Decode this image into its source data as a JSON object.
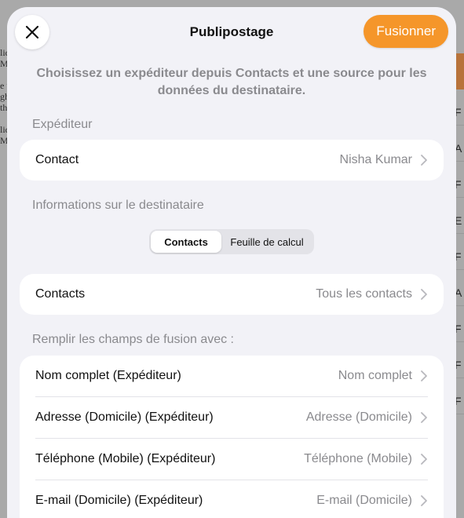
{
  "header": {
    "title": "Publipostage",
    "merge_label": "Fusionner"
  },
  "intro": "Choisissez un expéditeur depuis Contacts et une source pour les données du destinataire.",
  "sender": {
    "section_label": "Expéditeur",
    "row": {
      "label": "Contact",
      "value": "Nisha Kumar"
    }
  },
  "recipient": {
    "section_label": "Informations sur le destinataire",
    "segments": [
      "Contacts",
      "Feuille de calcul"
    ],
    "selected_segment": "Contacts",
    "row": {
      "label": "Contacts",
      "value": "Tous les contacts"
    }
  },
  "merge_fields": {
    "section_label": "Remplir les champs de fusion avec :",
    "rows": [
      {
        "label": "Nom complet (Expéditeur)",
        "value": "Nom complet"
      },
      {
        "label": "Adresse (Domicile) (Expéditeur)",
        "value": "Adresse (Domicile)"
      },
      {
        "label": "Téléphone (Mobile) (Expéditeur)",
        "value": "Téléphone (Mobile)"
      },
      {
        "label": "E-mail (Domicile) (Expéditeur)",
        "value": "E-mail (Domicile)"
      }
    ]
  },
  "background": {
    "left_fragments": [
      "lic",
      "M",
      "",
      "e t",
      "gh",
      "th",
      "",
      "lic",
      "M"
    ],
    "right_fragments": [
      "F",
      "A",
      "F",
      "E",
      "F",
      "A",
      "F",
      "F",
      "F"
    ]
  },
  "colors": {
    "accent": "#f5962a",
    "sheet": "#f2f2f7",
    "secondary_text": "#8a8a8e"
  }
}
